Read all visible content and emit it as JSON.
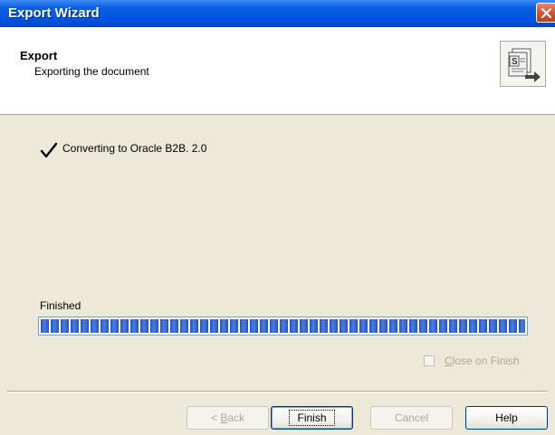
{
  "window": {
    "title": "Export Wizard"
  },
  "header": {
    "title": "Export",
    "subtitle": "Exporting the document",
    "icon": "export-document-icon"
  },
  "status": {
    "icon": "checkmark-icon",
    "text": "Converting to Oracle B2B. 2.0"
  },
  "progress": {
    "label": "Finished",
    "value_percent": 100,
    "color": "#2252c8"
  },
  "close_on_finish": {
    "label_prefix": "",
    "label_mnemonic": "C",
    "label_rest": "lose on Finish",
    "checked": false,
    "enabled": false
  },
  "buttons": {
    "back_arrow": "< ",
    "back_mnemonic": "B",
    "back_rest": "ack",
    "finish": "Finish",
    "cancel": "Cancel",
    "help": "Help"
  },
  "colors": {
    "titlebar": "#0055e5",
    "dialog_bg": "#ece9d8",
    "close_button": "#d8522f"
  }
}
